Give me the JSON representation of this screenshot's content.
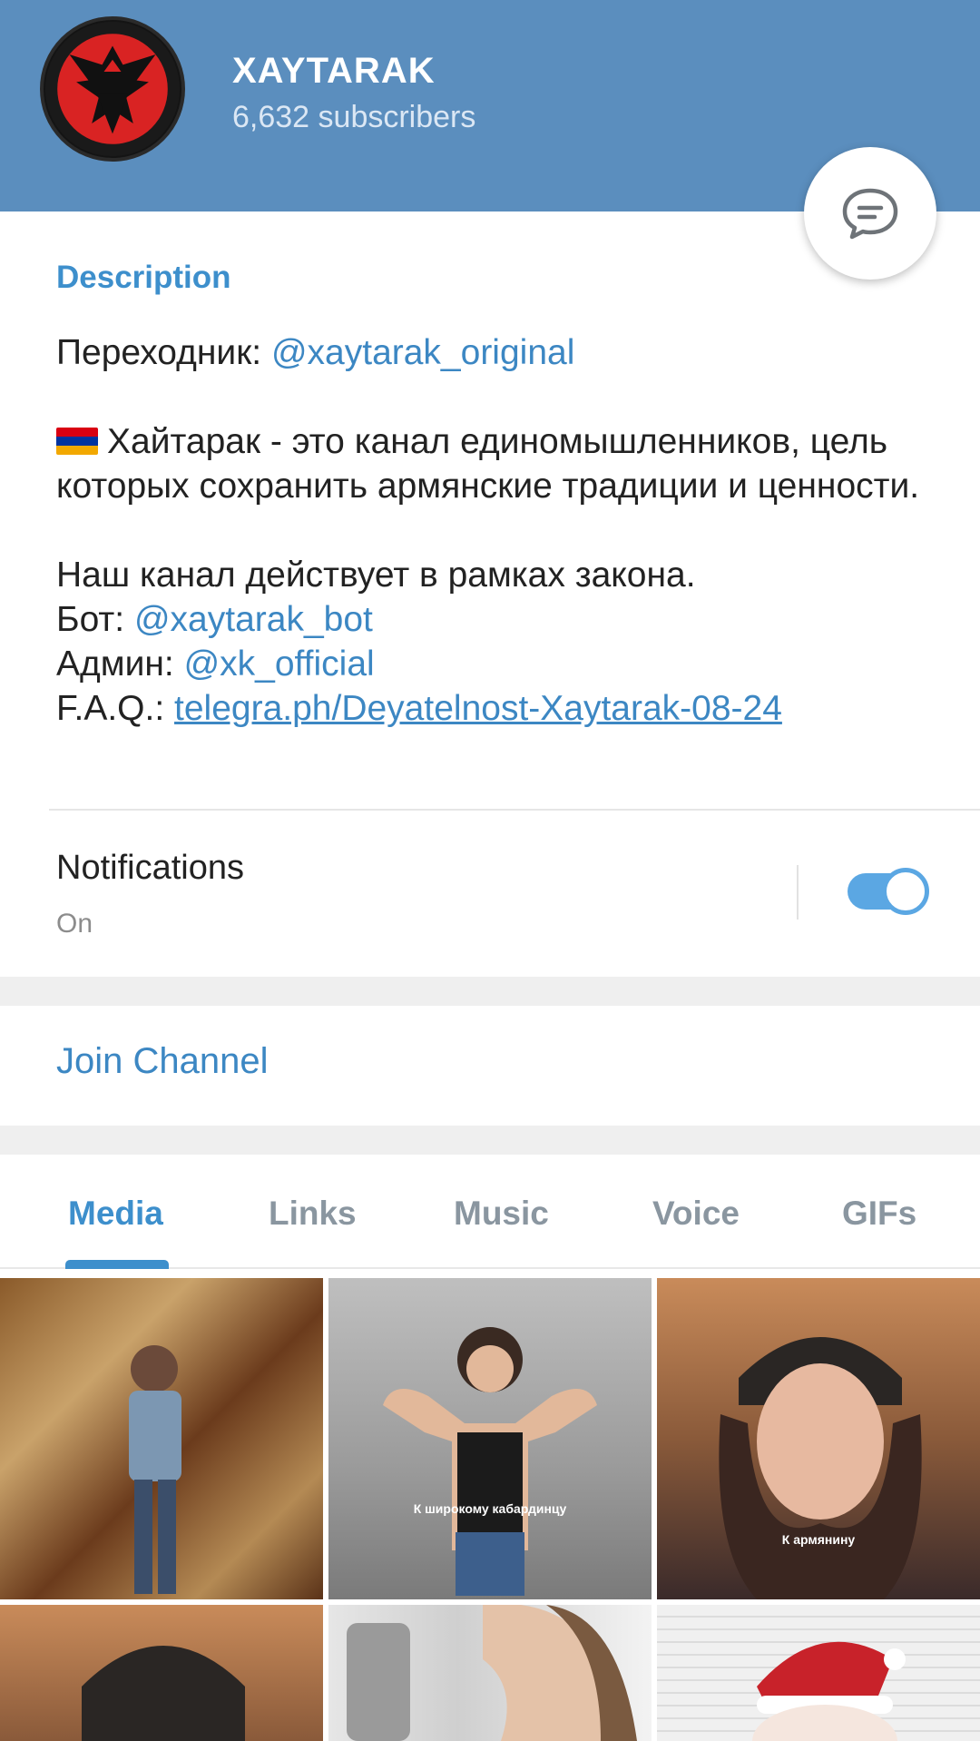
{
  "channel": {
    "title": "XAYTARAK",
    "subscribers": "6,632 subscribers"
  },
  "description": {
    "heading": "Description",
    "line1_prefix": "Переходник: ",
    "line1_link": "@xaytarak_original",
    "para2": "Хайтарак - это канал единомышленников, цель которых сохранить армянские традиции и ценности.",
    "para3": "Наш канал действует в рамках закона.",
    "bot_prefix": "Бот: ",
    "bot_link": "@xaytarak_bot",
    "admin_prefix": "Админ: ",
    "admin_link": "@xk_official",
    "faq_prefix": "F.A.Q.: ",
    "faq_link": "telegra.ph/Deyatelnost-Xaytarak-08-24"
  },
  "notifications": {
    "label": "Notifications",
    "state": "On",
    "enabled": true
  },
  "join": {
    "label": "Join Channel"
  },
  "tabs": [
    {
      "label": "Media",
      "active": true
    },
    {
      "label": "Links",
      "active": false
    },
    {
      "label": "Music",
      "active": false
    },
    {
      "label": "Voice",
      "active": false
    },
    {
      "label": "GIFs",
      "active": false
    }
  ],
  "media": {
    "caption_2": "К широкому кабардинцу",
    "caption_3": "К армянину"
  },
  "colors": {
    "header": "#5b8ebe",
    "accent": "#3d8fcc",
    "link": "#3c87c3",
    "toggle": "#5ba7e3"
  }
}
